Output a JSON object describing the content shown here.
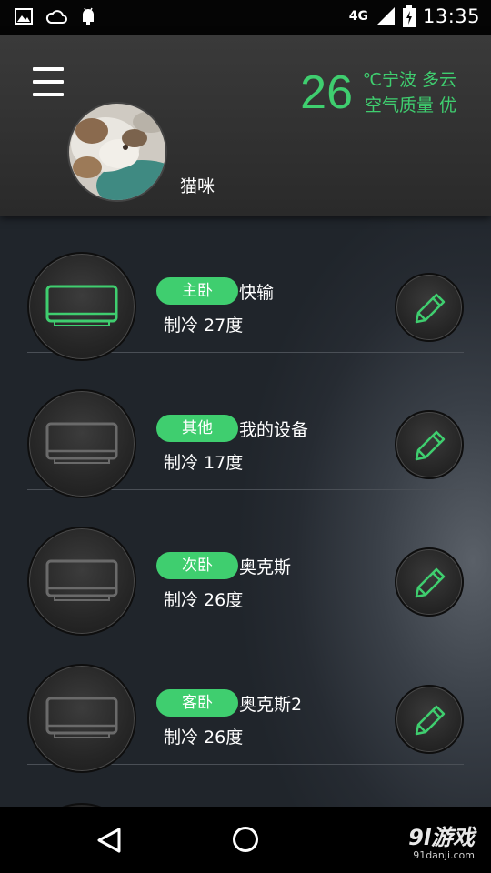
{
  "status_bar": {
    "network": "4G",
    "time": "13:35"
  },
  "header": {
    "username": "猫咪",
    "weather": {
      "temperature": "26",
      "line1": "℃宁波 多云",
      "line2": "空气质量 优"
    }
  },
  "devices": [
    {
      "room": "主卧",
      "name": "快输",
      "status": "制冷  27度",
      "active": true
    },
    {
      "room": "其他",
      "name": "我的设备",
      "status": "制冷  17度",
      "active": false
    },
    {
      "room": "次卧",
      "name": "奥克斯",
      "status": "制冷  26度",
      "active": false
    },
    {
      "room": "客卧",
      "name": "奥克斯2",
      "status": "制冷  26度",
      "active": false
    }
  ],
  "watermark": {
    "logo": "9l游戏",
    "url": "91danji.com"
  },
  "colors": {
    "accent": "#3fce6f",
    "inactive_icon": "#6a6a6a"
  }
}
